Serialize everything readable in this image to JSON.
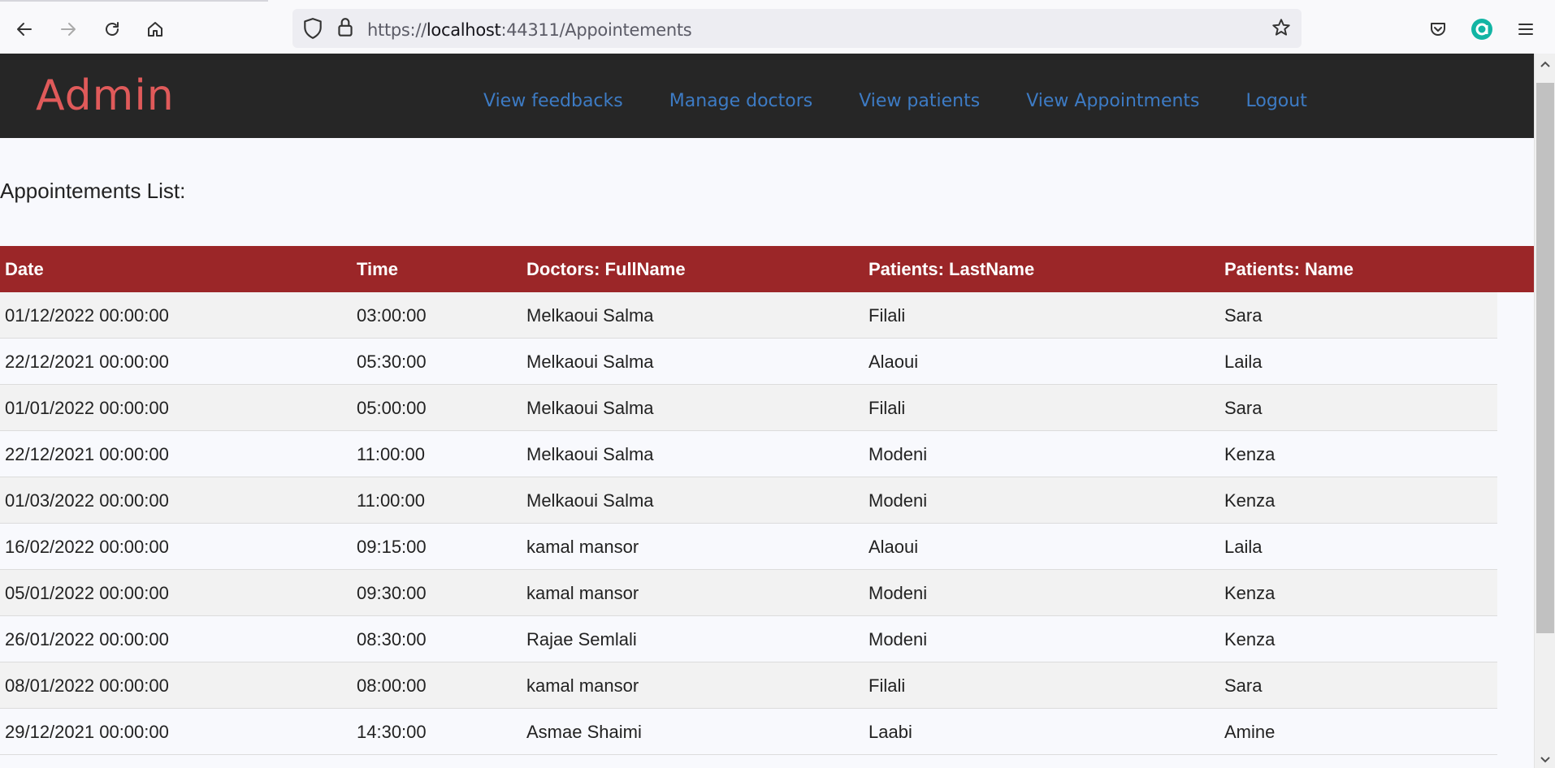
{
  "browser": {
    "url_scheme": "https://",
    "url_host": "localhost",
    "url_port_path": ":44311/Appointements"
  },
  "navbar": {
    "brand": "Admin",
    "links": [
      "View feedbacks",
      "Manage doctors",
      "View patients",
      "View Appointments",
      "Logout"
    ]
  },
  "page": {
    "title": "Appointements List:"
  },
  "table": {
    "headers": [
      "Date",
      "Time",
      "Doctors: FullName",
      "Patients: LastName",
      "Patients: Name"
    ],
    "rows": [
      [
        "01/12/2022 00:00:00",
        "03:00:00",
        "Melkaoui Salma",
        "Filali",
        "Sara"
      ],
      [
        "22/12/2021 00:00:00",
        "05:30:00",
        "Melkaoui Salma",
        "Alaoui",
        "Laila"
      ],
      [
        "01/01/2022 00:00:00",
        "05:00:00",
        "Melkaoui Salma",
        "Filali",
        "Sara"
      ],
      [
        "22/12/2021 00:00:00",
        "11:00:00",
        "Melkaoui Salma",
        "Modeni",
        "Kenza"
      ],
      [
        "01/03/2022 00:00:00",
        "11:00:00",
        "Melkaoui Salma",
        "Modeni",
        "Kenza"
      ],
      [
        "16/02/2022 00:00:00",
        "09:15:00",
        "kamal mansor",
        "Alaoui",
        "Laila"
      ],
      [
        "05/01/2022 00:00:00",
        "09:30:00",
        "kamal mansor",
        "Modeni",
        "Kenza"
      ],
      [
        "26/01/2022 00:00:00",
        "08:30:00",
        "Rajae Semlali",
        "Modeni",
        "Kenza"
      ],
      [
        "08/01/2022 00:00:00",
        "08:00:00",
        "kamal mansor",
        "Filali",
        "Sara"
      ],
      [
        "29/12/2021 00:00:00",
        "14:30:00",
        "Asmae Shaimi",
        "Laabi",
        "Amine"
      ]
    ]
  },
  "colors": {
    "navbar_bg": "#262626",
    "brand": "#e05a5a",
    "nav_link": "#3d7bc4",
    "table_header_bg": "#9b2628"
  },
  "icons": [
    "back-icon",
    "forward-icon",
    "reload-icon",
    "home-icon",
    "shield-icon",
    "lock-icon",
    "bookmark-star-icon",
    "pocket-icon",
    "account-icon",
    "menu-icon"
  ]
}
